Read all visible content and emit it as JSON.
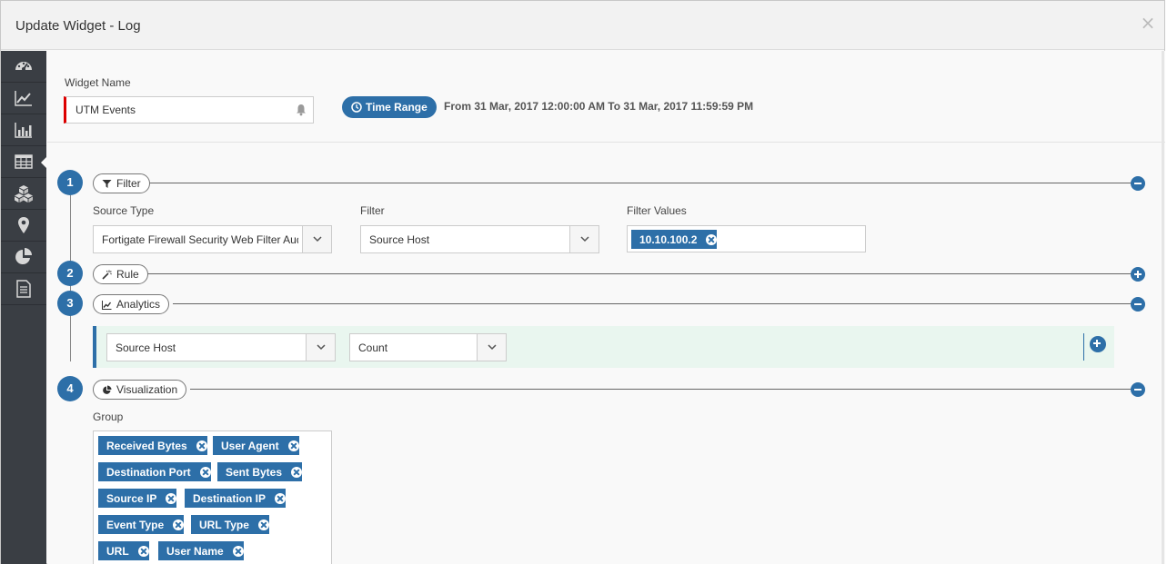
{
  "dialog": {
    "title": "Update Widget - Log",
    "close_glyph": "×"
  },
  "sidebar": {
    "items": [
      {
        "icon": "dashboard-gauge-icon"
      },
      {
        "icon": "line-chart-icon"
      },
      {
        "icon": "bar-chart-icon"
      },
      {
        "icon": "table-icon",
        "active": true
      },
      {
        "icon": "cubes-icon"
      },
      {
        "icon": "map-marker-icon"
      },
      {
        "icon": "pie-chart-icon"
      },
      {
        "icon": "document-icon"
      }
    ]
  },
  "widget": {
    "name_label": "Widget Name",
    "name_value": "UTM Events",
    "time_range_label": "Time Range",
    "time_range_text": "From 31 Mar, 2017 12:00:00 AM To 31 Mar, 2017 11:59:59 PM"
  },
  "steps": [
    {
      "number": "1",
      "label": "Filter"
    },
    {
      "number": "2",
      "label": "Rule"
    },
    {
      "number": "3",
      "label": "Analytics"
    },
    {
      "number": "4",
      "label": "Visualization"
    }
  ],
  "filter": {
    "source_type_label": "Source Type",
    "source_type_value": "Fortigate Firewall Security Web Filter Audit",
    "filter_label": "Filter",
    "filter_value": "Source Host",
    "values_label": "Filter Values",
    "values": [
      "10.10.100.2"
    ]
  },
  "analytics": {
    "field_value": "Source Host",
    "function_value": "Count"
  },
  "visualization": {
    "group_label": "Group",
    "groups": [
      "Received Bytes",
      "User Agent",
      "Destination Port",
      "Sent Bytes",
      "Source IP",
      "Destination IP",
      "Event Type",
      "URL Type",
      "URL",
      "User Name"
    ]
  },
  "colors": {
    "accent": "#2d6fa8",
    "sidebar_bg": "#3a3e44",
    "required_marker": "#dd0000",
    "analytics_row_bg": "#e9f6ef"
  }
}
